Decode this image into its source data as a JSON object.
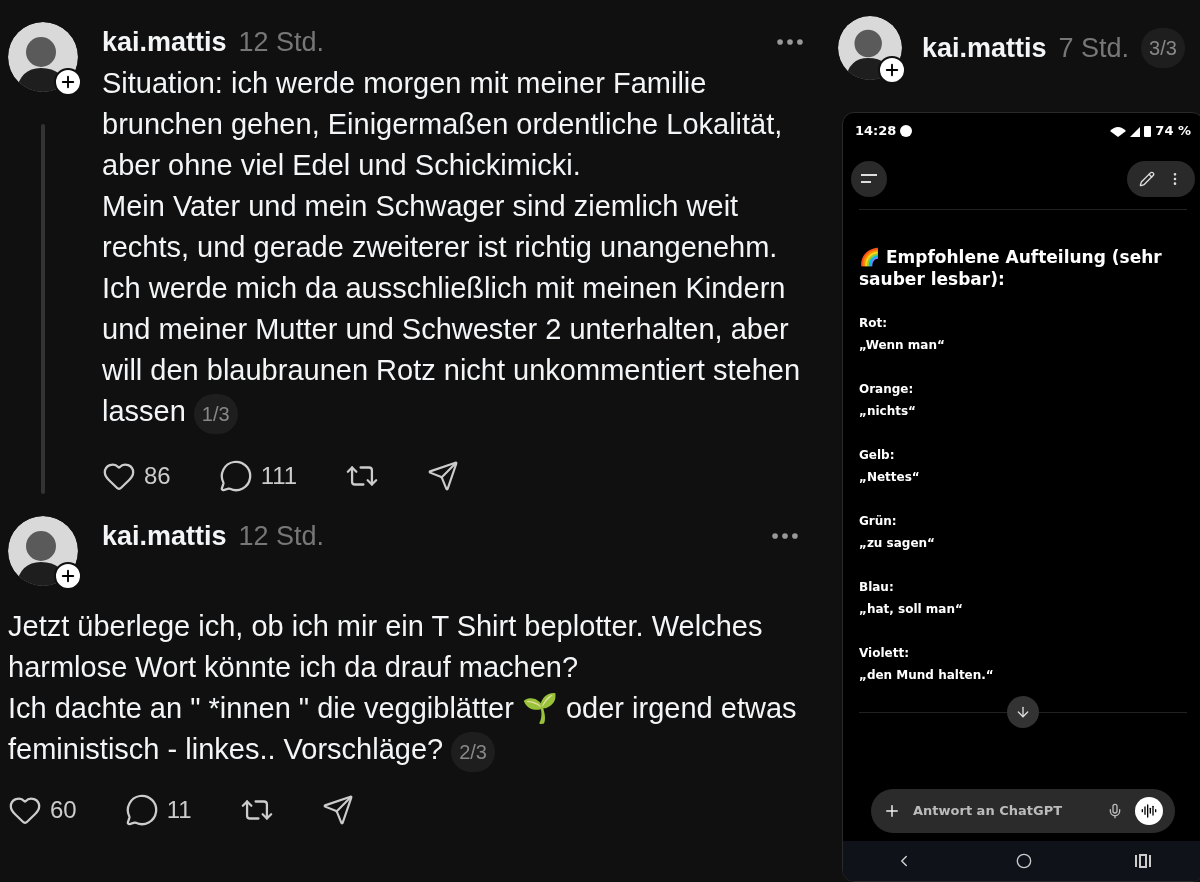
{
  "posts": [
    {
      "username": "kai.mattis",
      "time": "12 Std.",
      "thread_line": true,
      "paragraphs": [
        "Situation: ich werde morgen mit meiner Familie brunchen gehen, Einigermaßen ordentliche Lokalität, aber ohne viel Edel und Schickimicki.",
        "Mein Vater und mein Schwager sind ziemlich weit rechts, und gerade zweiterer ist richtig unangenehm. Ich werde mich da ausschließlich mit meinen Kindern und meiner Mutter und Schwester 2 unterhalten, aber will den blaubraunen Rotz nicht unkommentiert stehen lassen"
      ],
      "page": "1/3",
      "likes": "86",
      "comments": "111"
    },
    {
      "username": "kai.mattis",
      "time": "12 Std.",
      "thread_line": false,
      "paragraphs": [
        "Jetzt überlege ich, ob ich mir ein T Shirt beplotter. Welches harmlose Wort könnte ich da drauf machen?",
        "Ich dachte an \" *innen \" die veggiblätter 🌱 oder irgend etwas feministisch - linkes.. Vorschläge?"
      ],
      "page": "2/3",
      "likes": "60",
      "comments": "11"
    }
  ],
  "side_post": {
    "username": "kai.mattis",
    "time": "7 Std.",
    "page": "3/3",
    "phone": {
      "clock": "14:28",
      "battery": "74 %",
      "heading": "🌈 Empfohlene Aufteilung (sehr sauber lesbar):",
      "parts": [
        {
          "label": "Rot:",
          "text": "„Wenn man“"
        },
        {
          "label": "Orange:",
          "text": "„nichts“"
        },
        {
          "label": "Gelb:",
          "text": "„Nettes“"
        },
        {
          "label": "Grün:",
          "text": "„zu sagen“"
        },
        {
          "label": "Blau:",
          "text": "„hat, soll man“"
        },
        {
          "label": "Violett:",
          "text": "„den Mund halten.“"
        }
      ],
      "input": {
        "placeholder": "Antwort an ChatGPT"
      }
    }
  }
}
